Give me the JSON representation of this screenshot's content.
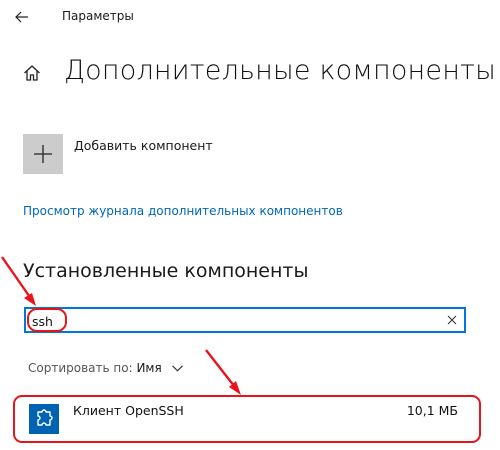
{
  "window": {
    "title": "Параметры",
    "back_icon": "arrow-left-icon"
  },
  "header": {
    "home_icon": "home-icon",
    "title": "Дополнительные компоненты"
  },
  "add_component": {
    "icon": "plus-icon",
    "label": "Добавить компонент"
  },
  "history_link": {
    "label": "Просмотр журнала дополнительных компонентов"
  },
  "installed": {
    "section_title": "Установленные компоненты",
    "search": {
      "value": "ssh",
      "clear_icon": "close-icon"
    },
    "sort": {
      "label": "Сортировать по:",
      "value": "Имя",
      "chevron_icon": "chevron-down-icon"
    },
    "items": [
      {
        "name": "Клиент OpenSSH",
        "size": "10,1 МБ",
        "icon": "puzzle-gear-icon"
      }
    ]
  },
  "colors": {
    "accent": "#0078d7",
    "link": "#0067b8",
    "tile_gray": "#cccccc",
    "item_icon_bg": "#0063b1",
    "annotation_red": "#e8141b"
  }
}
